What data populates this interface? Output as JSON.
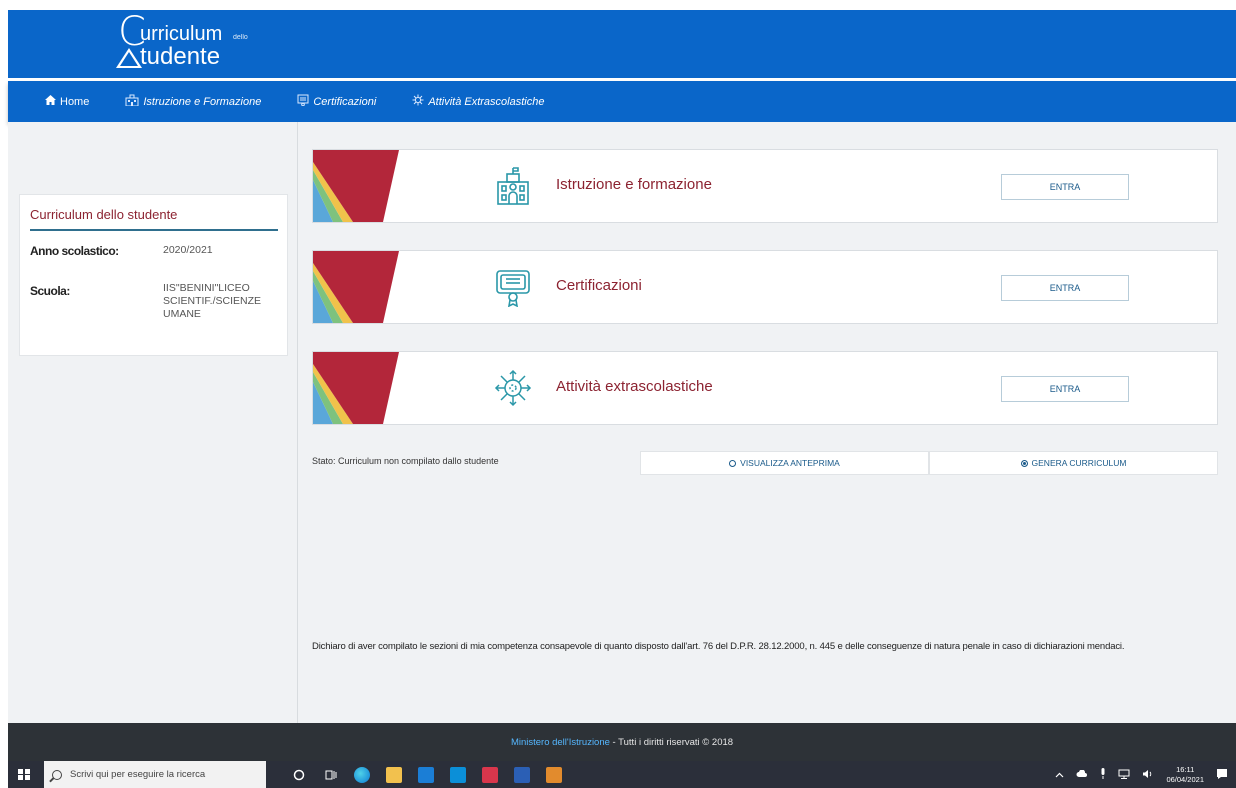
{
  "header": {
    "logo_c": "C",
    "logo_line1": "urriculum",
    "logo_dello": "dello",
    "logo_line2": "tudente"
  },
  "nav": {
    "items": [
      {
        "label": "Home",
        "icon": "home-icon"
      },
      {
        "label": "Istruzione e Formazione",
        "icon": "school-building-icon"
      },
      {
        "label": "Certificazioni",
        "icon": "certificate-icon"
      },
      {
        "label": "Attività Extrascolastiche",
        "icon": "virus-activity-icon"
      }
    ]
  },
  "profile": {
    "title": "Curriculum dello studente",
    "rows": [
      {
        "label": "Anno scolastico:",
        "value": "2020/2021"
      },
      {
        "label": "Scuola:",
        "value": "IIS\"BENINI\"LICEO SCIENTIF./SCIENZE UMANE"
      }
    ]
  },
  "sections": [
    {
      "title": "Istruzione e formazione",
      "button": "ENTRA",
      "icon": "school-building-icon"
    },
    {
      "title": "Certificazioni",
      "button": "ENTRA",
      "icon": "certificate-icon"
    },
    {
      "title": "Attività extrascolastiche",
      "button": "ENTRA",
      "icon": "activity-network-icon"
    }
  ],
  "status": "Stato: Curriculum non compilato dallo studente",
  "actions": {
    "preview": "VISUALIZZA ANTEPRIMA",
    "generate": "GENERA CURRICULUM"
  },
  "declaration": "Dichiaro di aver compilato le sezioni di mia competenza consapevole di quanto disposto dall'art. 76 del D.P.R. 28.12.2000, n. 445 e delle conseguenze di natura penale in caso di dichiarazioni mendaci.",
  "footer": {
    "ministry": "Ministero dell'Istruzione",
    "rights": " - Tutti i diritti riservati © 2018"
  },
  "taskbar": {
    "search_placeholder": "Scrivi qui per eseguire la ricerca",
    "time": "16:11",
    "date": "06/04/2021"
  },
  "colors": {
    "brand_blue": "#0a66c9",
    "title_red": "#8c2331",
    "footer_bg": "#2d3237"
  }
}
